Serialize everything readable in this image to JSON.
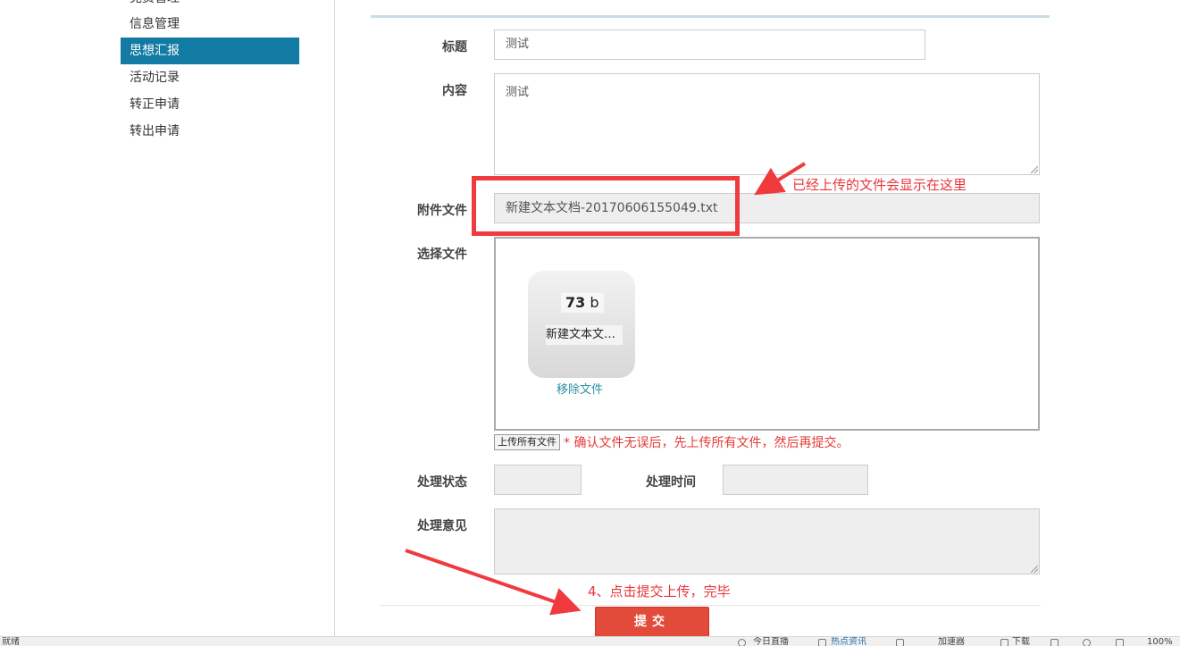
{
  "sidebar": {
    "items": [
      {
        "label": "党费管理"
      },
      {
        "label": "信息管理"
      },
      {
        "label": "思想汇报",
        "active": true
      },
      {
        "label": "活动记录"
      },
      {
        "label": "转正申请"
      },
      {
        "label": "转出申请"
      }
    ]
  },
  "form": {
    "title_label": "标题",
    "title_value": "测试",
    "content_label": "内容",
    "content_value": "测试",
    "attachment_label": "附件文件",
    "attachment_value": "新建文本文档-20170606155049.txt",
    "choose_file_label": "选择文件",
    "file_card": {
      "size_number": "73",
      "size_unit": "b",
      "file_name": "新建文本文档.txt",
      "remove_label": "移除文件"
    },
    "upload_all_label": "上传所有文件",
    "upload_note": "* 确认文件无误后，先上传所有文件，然后再提交。",
    "status_label": "处理状态",
    "status_value": "",
    "time_label": "处理时间",
    "time_value": "",
    "opinion_label": "处理意见",
    "opinion_value": "",
    "submit_label": "提交"
  },
  "annotations": {
    "uploaded_note": "已经上传的文件会显示在这里",
    "step4_note": "4、点击提交上传，完毕",
    "color": "#ef3a3e"
  },
  "statusbar": {
    "left_text": "就绪",
    "items": [
      "今日直播",
      "热点资讯",
      "加速器",
      "下载",
      "100%"
    ]
  },
  "colors": {
    "sidebar_active": "#127ba3",
    "submit": "#e24b3a",
    "link": "#2a8fa6"
  }
}
